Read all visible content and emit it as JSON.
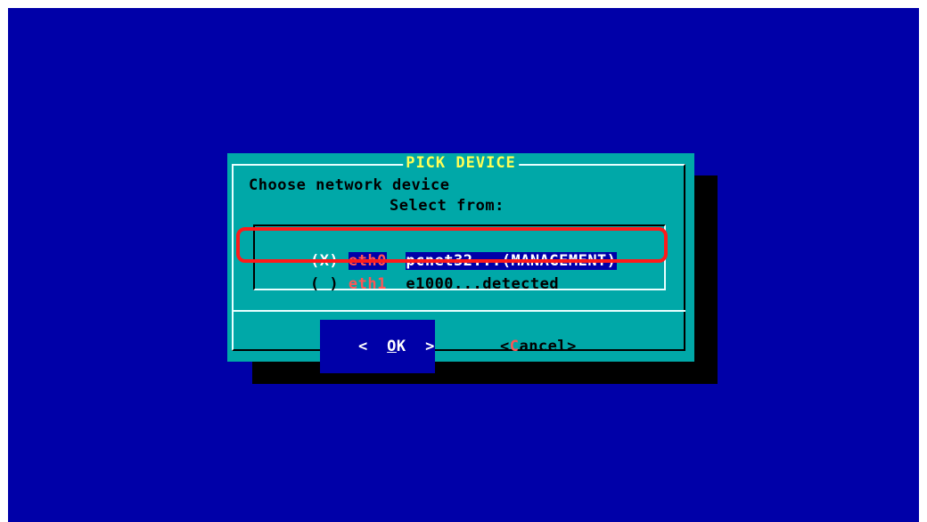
{
  "dialog": {
    "title": "PICK DEVICE",
    "prompt": "Choose network device",
    "subprompt": "Select from:"
  },
  "devices": [
    {
      "marker": "(X)",
      "tag": "eth0",
      "description": "pcnet32...(MANAGEMENT)",
      "selected": true
    },
    {
      "marker": "( )",
      "tag": "eth1",
      "description": "e1000...detected",
      "selected": false
    }
  ],
  "buttons": {
    "ok": {
      "left": "<  ",
      "hot": "O",
      "rest": "K  >"
    },
    "cancel": {
      "left": "<",
      "hot": "C",
      "rest": "ancel>"
    }
  },
  "colors": {
    "screen_bg": "#0000a8",
    "dialog_bg": "#00a8a8",
    "title": "#ffff55",
    "highlight": "#ff1a1a"
  }
}
